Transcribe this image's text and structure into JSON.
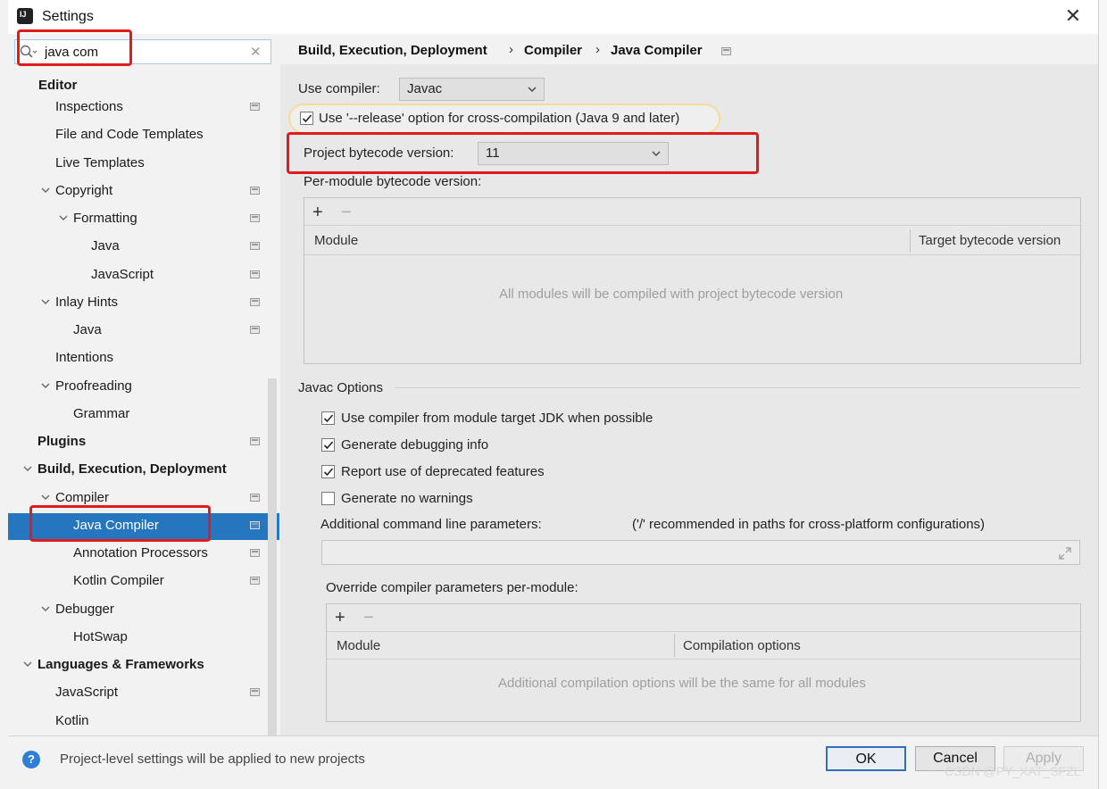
{
  "window": {
    "title": "Settings",
    "close_glyph": "✕"
  },
  "search": {
    "value": "java com",
    "clear_glyph": "✕"
  },
  "tree": [
    {
      "label": "Editor",
      "bold": true
    },
    {
      "label": "Inspections"
    },
    {
      "label": "File and Code Templates"
    },
    {
      "label": "Live Templates"
    },
    {
      "label": "Copyright",
      "expanded": true
    },
    {
      "label": "Formatting",
      "expanded": true
    },
    {
      "label": "Java"
    },
    {
      "label": "JavaScript"
    },
    {
      "label": "Inlay Hints",
      "expanded": true
    },
    {
      "label": "Java"
    },
    {
      "label": "Intentions"
    },
    {
      "label": "Proofreading",
      "expanded": true
    },
    {
      "label": "Grammar"
    },
    {
      "label": "Plugins",
      "bold": true
    },
    {
      "label": "Build, Execution, Deployment",
      "bold": true,
      "expanded": true
    },
    {
      "label": "Compiler",
      "expanded": true
    },
    {
      "label": "Java Compiler",
      "selected": true
    },
    {
      "label": "Annotation Processors"
    },
    {
      "label": "Kotlin Compiler"
    },
    {
      "label": "Debugger",
      "expanded": true
    },
    {
      "label": "HotSwap"
    },
    {
      "label": "Languages & Frameworks",
      "bold": true,
      "expanded": true
    },
    {
      "label": "JavaScript"
    },
    {
      "label": "Kotlin"
    }
  ],
  "breadcrumb": {
    "items": [
      "Build, Execution, Deployment",
      "Compiler",
      "Java Compiler"
    ],
    "separator": "›"
  },
  "compiler": {
    "use_compiler_label": "Use compiler:",
    "use_compiler_value": "Javac",
    "release_option_label": "Use '--release' option for cross-compilation (Java 9 and later)",
    "release_option_checked": true,
    "project_bytecode_label": "Project bytecode version:",
    "project_bytecode_value": "11",
    "per_module_label": "Per-module bytecode version:",
    "module_table": {
      "plus": "+",
      "minus": "−",
      "columns": [
        "Module",
        "Target bytecode version"
      ],
      "empty_text": "All modules will be compiled with project bytecode version"
    }
  },
  "javac": {
    "section_title": "Javac Options",
    "options": [
      {
        "label": "Use compiler from module target JDK when possible",
        "checked": true
      },
      {
        "label": "Generate debugging info",
        "checked": true
      },
      {
        "label": "Report use of deprecated features",
        "checked": true
      },
      {
        "label": "Generate no warnings",
        "checked": false
      }
    ],
    "additional_params_label": "Additional command line parameters:",
    "additional_params_hint": "('/' recommended in paths for cross-platform configurations)",
    "override_label": "Override compiler parameters per-module:",
    "override_table": {
      "plus": "+",
      "minus": "−",
      "columns": [
        "Module",
        "Compilation options"
      ],
      "empty_text": "Additional compilation options will be the same for all modules"
    }
  },
  "footer": {
    "help_glyph": "?",
    "note": "Project-level settings will be applied to new projects",
    "ok": "OK",
    "cancel": "Cancel",
    "apply": "Apply"
  },
  "watermark": "CSDN @PY_XAT_SFZL",
  "colors": {
    "selection": "#2675bf",
    "annotation_red": "#e11b1b",
    "pill_border": "#f7dc94"
  }
}
